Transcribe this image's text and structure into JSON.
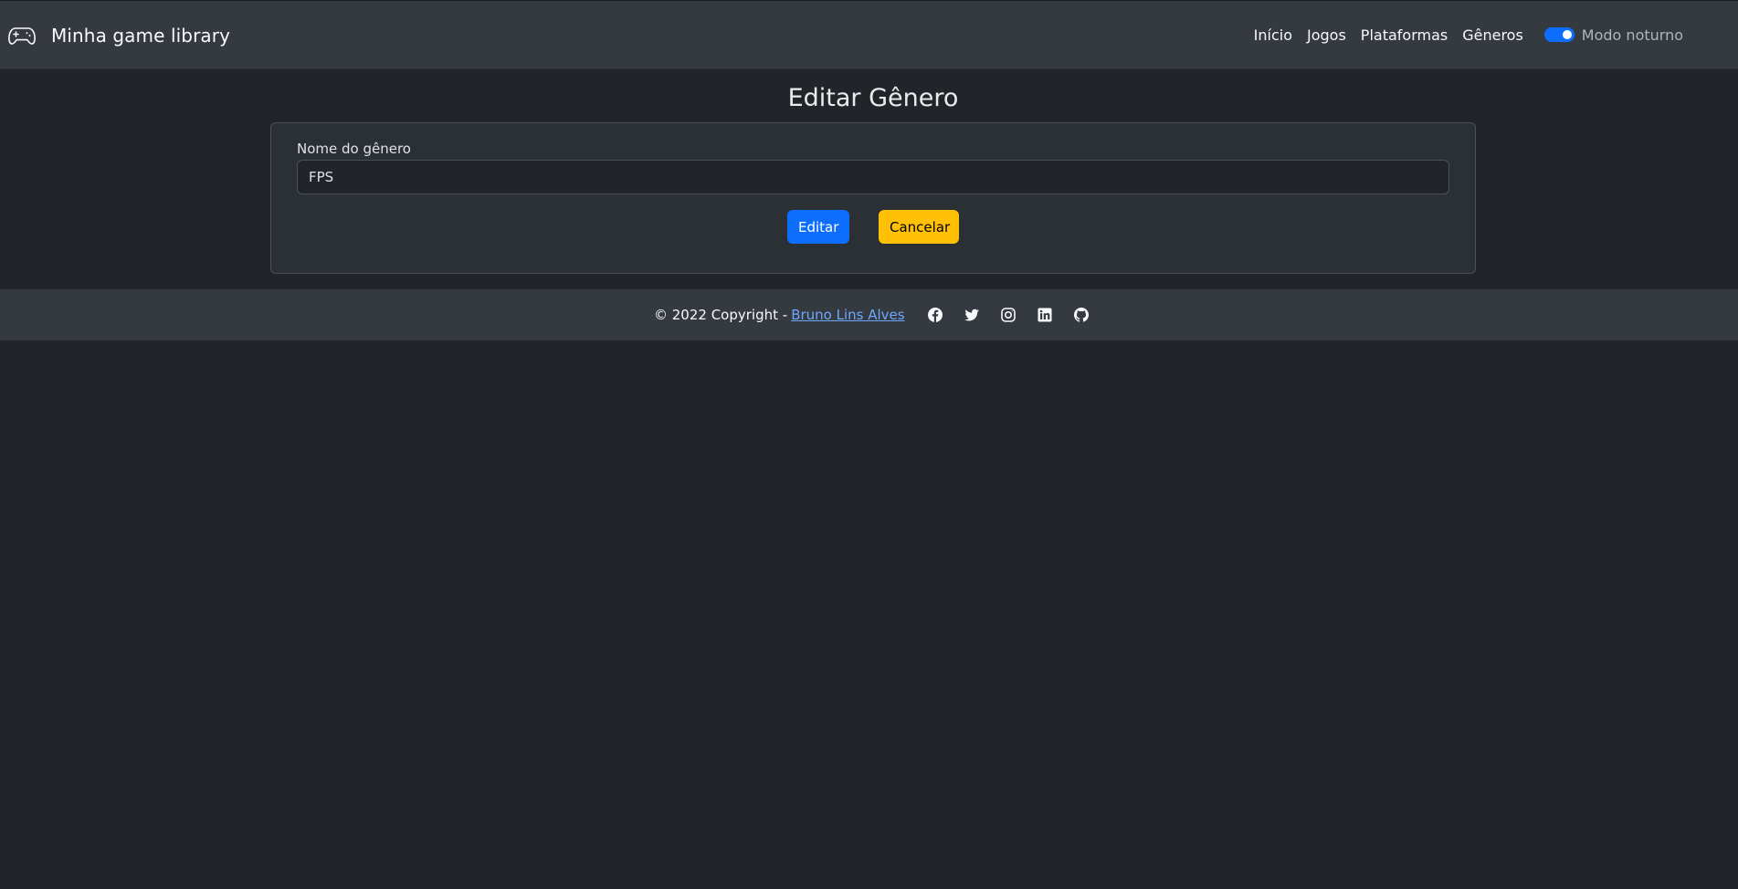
{
  "navbar": {
    "brand": {
      "title": "Minha game library",
      "icon": "gamepad-icon"
    },
    "links": [
      {
        "label": "Início"
      },
      {
        "label": "Jogos"
      },
      {
        "label": "Plataformas"
      },
      {
        "label": "Gêneros"
      }
    ],
    "theme_toggle": {
      "label": "Modo noturno",
      "checked": true
    }
  },
  "main": {
    "title": "Editar Gênero",
    "form": {
      "label": "Nome do gênero",
      "value": "FPS",
      "submit_label": "Editar",
      "cancel_label": "Cancelar"
    }
  },
  "footer": {
    "copyright": "© 2022 Copyright -",
    "author": "Bruno Lins Alves",
    "social_icons": [
      "facebook-icon",
      "twitter-icon",
      "instagram-icon",
      "linkedin-icon",
      "github-icon"
    ]
  },
  "colors": {
    "page_bg": "#212529",
    "navbar_bg": "#343a40",
    "primary": "#0d6efd",
    "warning": "#ffc107",
    "link": "#6ea8fe"
  }
}
